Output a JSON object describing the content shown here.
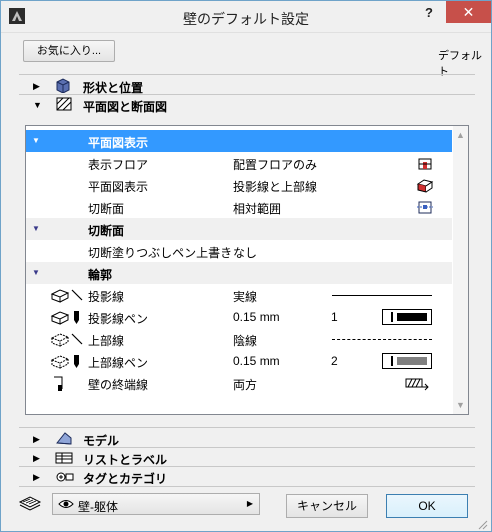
{
  "window": {
    "title": "壁のデフォルト設定",
    "help": "?",
    "close": "✕"
  },
  "toolbar": {
    "favorites_label": "お気に入り...",
    "default_label": "デフォルト"
  },
  "sections": [
    {
      "label": "形状と位置",
      "icon": "geometry-icon",
      "expanded": false
    },
    {
      "label": "平面図と断面図",
      "icon": "floorplan-section-icon",
      "expanded": true
    },
    {
      "label": "モデル",
      "icon": "model-icon",
      "expanded": false
    },
    {
      "label": "リストとラベル",
      "icon": "list-label-icon",
      "expanded": false
    },
    {
      "label": "タグとカテゴリ",
      "icon": "tag-category-icon",
      "expanded": false
    }
  ],
  "panel": {
    "groups": [
      {
        "title": "平面図表示",
        "selected": true
      },
      {
        "title": "切断面"
      },
      {
        "title": "輪郭"
      }
    ],
    "rows": {
      "show_floor": {
        "name": "表示フロア",
        "value": "配置フロアのみ"
      },
      "plan_display": {
        "name": "平面図表示",
        "value": "投影線と上部線"
      },
      "cut_surface": {
        "name": "切断面",
        "value": "相対範囲"
      },
      "cut_fill_override": {
        "name": "切断塗りつぶしペン上書き",
        "value": "なし"
      },
      "projected_line": {
        "name": "投影線",
        "value": "実線"
      },
      "projected_pen": {
        "name": "投影線ペン",
        "value": "0.15 mm",
        "pen": "1"
      },
      "overhead_line": {
        "name": "上部線",
        "value": "陰線"
      },
      "overhead_pen": {
        "name": "上部線ペン",
        "value": "0.15 mm",
        "pen": "2"
      },
      "wall_end_lines": {
        "name": "壁の終端線",
        "value": "両方"
      }
    }
  },
  "footer": {
    "layer_value": "壁-躯体",
    "cancel_label": "キャンセル",
    "ok_label": "OK"
  },
  "colors": {
    "selection": "#3399ff",
    "close": "#c7504a",
    "accent_red": "#d03030"
  }
}
